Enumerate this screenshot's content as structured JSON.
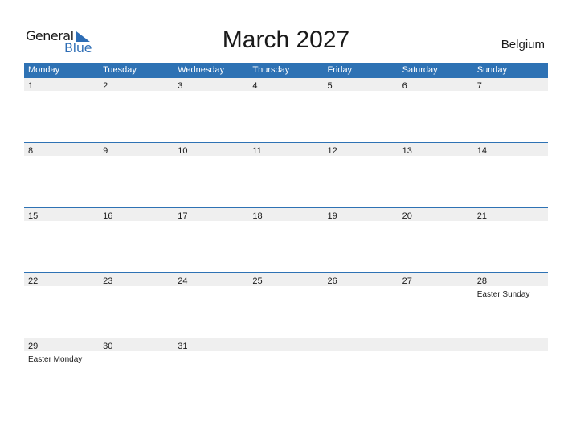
{
  "logo": {
    "line1": "General",
    "line2": "Blue",
    "icon": "triangle-flag-icon"
  },
  "title": "March 2027",
  "country": "Belgium",
  "colors": {
    "accent": "#2e72b4",
    "date_row_bg": "#efefef"
  },
  "weekdays": [
    "Monday",
    "Tuesday",
    "Wednesday",
    "Thursday",
    "Friday",
    "Saturday",
    "Sunday"
  ],
  "weeks": [
    {
      "days": [
        "1",
        "2",
        "3",
        "4",
        "5",
        "6",
        "7"
      ],
      "events": [
        "",
        "",
        "",
        "",
        "",
        "",
        ""
      ]
    },
    {
      "days": [
        "8",
        "9",
        "10",
        "11",
        "12",
        "13",
        "14"
      ],
      "events": [
        "",
        "",
        "",
        "",
        "",
        "",
        ""
      ]
    },
    {
      "days": [
        "15",
        "16",
        "17",
        "18",
        "19",
        "20",
        "21"
      ],
      "events": [
        "",
        "",
        "",
        "",
        "",
        "",
        ""
      ]
    },
    {
      "days": [
        "22",
        "23",
        "24",
        "25",
        "26",
        "27",
        "28"
      ],
      "events": [
        "",
        "",
        "",
        "",
        "",
        "",
        "Easter Sunday"
      ]
    },
    {
      "days": [
        "29",
        "30",
        "31",
        "",
        "",
        "",
        ""
      ],
      "events": [
        "Easter Monday",
        "",
        "",
        "",
        "",
        "",
        ""
      ]
    }
  ]
}
